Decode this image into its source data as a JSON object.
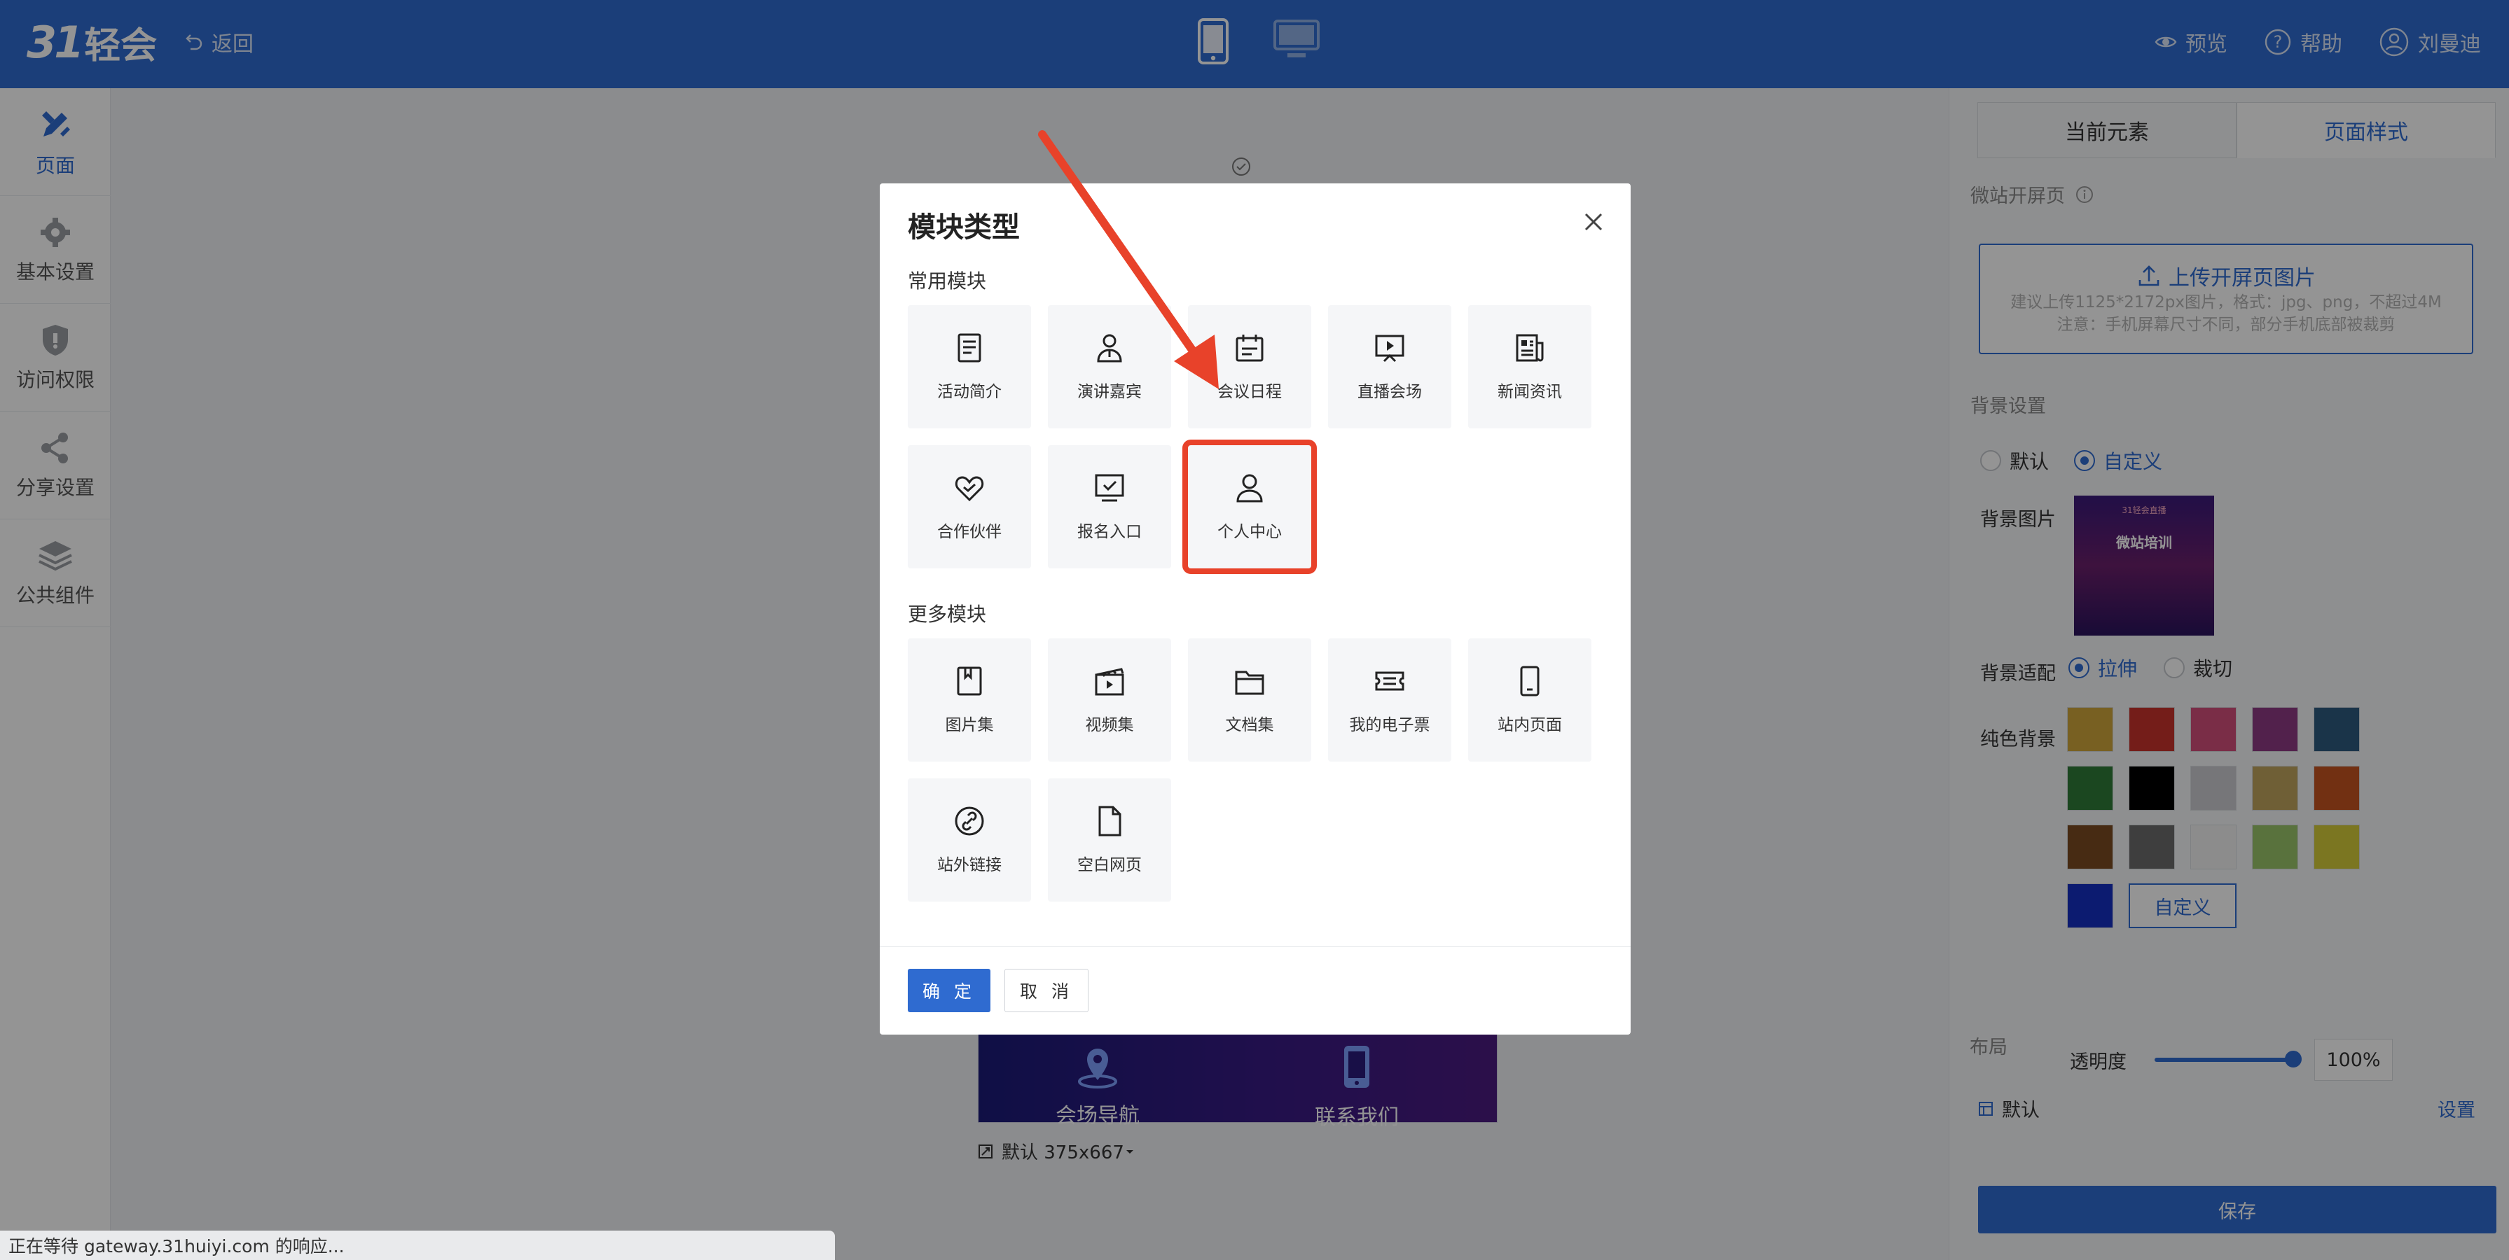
{
  "header": {
    "logo_number": "31",
    "logo_name": "轻会",
    "back_label": "返回",
    "preview_label": "预览",
    "help_label": "帮助",
    "user_name": "刘曼迪"
  },
  "leftnav": {
    "items": [
      {
        "label": "页面",
        "icon": "pencil-ruler-icon",
        "active": true
      },
      {
        "label": "基本设置",
        "icon": "gear-icon",
        "active": false
      },
      {
        "label": "访问权限",
        "icon": "shield-icon",
        "active": false
      },
      {
        "label": "分享设置",
        "icon": "share-icon",
        "active": false
      },
      {
        "label": "公共组件",
        "icon": "layers-icon",
        "active": false
      }
    ]
  },
  "canvas": {
    "preview_items": [
      "会场导航",
      "联系我们"
    ],
    "size_label": "默认 375x667"
  },
  "right_panel": {
    "tabs": [
      "当前元素",
      "页面样式"
    ],
    "splash_title": "微站开屏页",
    "upload_label": "上传开屏页图片",
    "upload_hint_1": "建议上传1125*2172px图片，格式：jpg、png，不超过4M",
    "upload_hint_2": "注意：手机屏幕尺寸不同，部分手机底部被裁剪",
    "bg_section_title": "背景设置",
    "bg_mode_default": "默认",
    "bg_mode_custom": "自定义",
    "bg_image_label": "背景图片",
    "bg_thumb_text": "微站培训",
    "bg_thumb_subtext": "31轻会直播",
    "bg_fit_label": "背景适配",
    "fit_stretch": "拉伸",
    "fit_crop": "裁切",
    "solid_bg_label": "纯色背景",
    "swatch_colors": [
      "#cfa63c",
      "#c8322c",
      "#d24f7a",
      "#8e3a84",
      "#2d5a7e",
      "#2f7a38",
      "#000000",
      "#cbcbd0",
      "#bfa45e",
      "#c4531f",
      "#7a4a22",
      "#6c6c6c",
      "#f2f2f2",
      "#99c46a",
      "#d5cc3a",
      "#1530c2"
    ],
    "swatch_custom_label": "自定义",
    "opacity_label": "透明度",
    "opacity_value": "100%",
    "opacity_fraction": 1.0,
    "layout_title": "布局",
    "layout_default": "默认",
    "layout_setting": "设置",
    "save_label": "保存"
  },
  "modal": {
    "title": "模块类型",
    "common_title": "常用模块",
    "common_tiles": [
      {
        "label": "活动简介",
        "icon": "document-lines-icon"
      },
      {
        "label": "演讲嘉宾",
        "icon": "speaker-person-icon"
      },
      {
        "label": "会议日程",
        "icon": "calendar-icon"
      },
      {
        "label": "直播会场",
        "icon": "live-screen-icon"
      },
      {
        "label": "新闻资讯",
        "icon": "newspaper-icon"
      },
      {
        "label": "合作伙伴",
        "icon": "handshake-heart-icon"
      },
      {
        "label": "报名入口",
        "icon": "monitor-check-icon"
      },
      {
        "label": "个人中心",
        "icon": "user-icon",
        "highlighted": true
      }
    ],
    "more_title": "更多模块",
    "more_tiles": [
      {
        "label": "图片集",
        "icon": "image-book-icon"
      },
      {
        "label": "视频集",
        "icon": "video-clapper-icon"
      },
      {
        "label": "文档集",
        "icon": "folder-icon"
      },
      {
        "label": "我的电子票",
        "icon": "ticket-icon"
      },
      {
        "label": "站内页面",
        "icon": "mobile-page-icon"
      },
      {
        "label": "站外链接",
        "icon": "link-icon"
      },
      {
        "label": "空白网页",
        "icon": "blank-page-icon"
      }
    ],
    "ok_label": "确 定",
    "cancel_label": "取 消"
  },
  "annotation": {
    "arrow_color": "#e8422a"
  },
  "statusbar": {
    "text": "正在等待 gateway.31huiyi.com 的响应..."
  },
  "colors": {
    "primary": "#2f6bd0",
    "highlight": "#e8422a"
  }
}
